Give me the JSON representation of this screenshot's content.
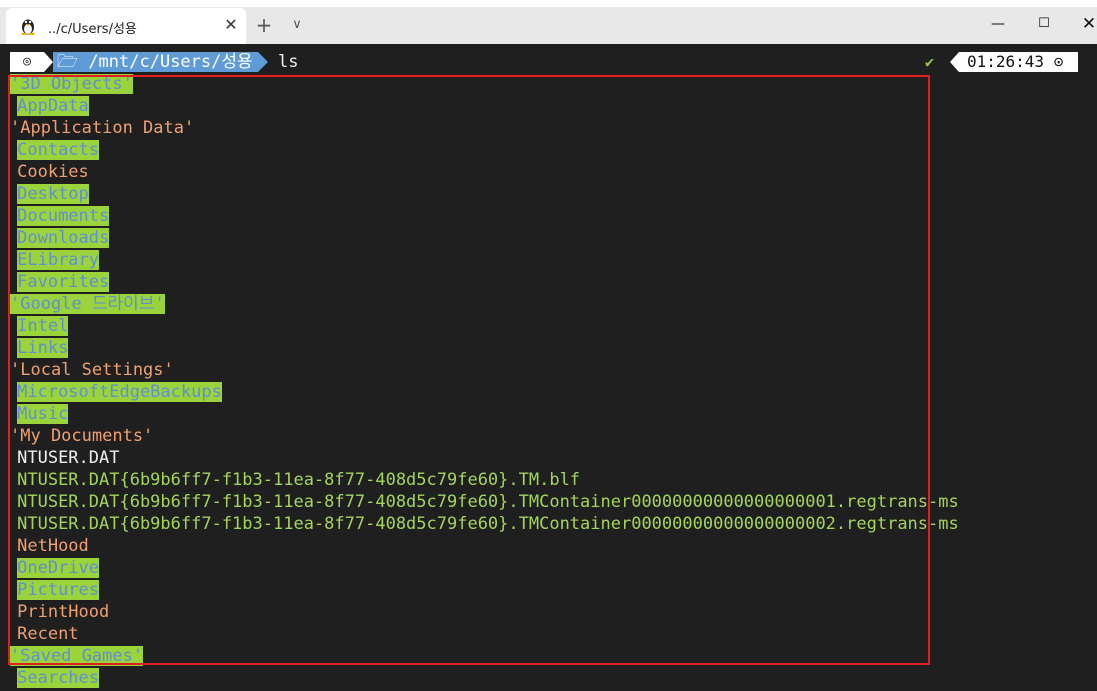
{
  "window": {
    "tab_title": "../c/Users/성용",
    "tab_icon": "linux-penguin-icon",
    "new_tab": "+",
    "tab_menu": "∨",
    "close_tab": "✕",
    "minimize": "—",
    "maximize": "☐",
    "close": "✕"
  },
  "prompt": {
    "os_icon": "◎",
    "path": "🗁 /mnt/c/Users/성용",
    "command": "ls",
    "status_icon": "✔",
    "time": "01:26:43 ⊙"
  },
  "colors": {
    "highlight_bg": "#9bd43a",
    "highlight_fg": "#5f8fd3",
    "orange": "#f0a070",
    "green": "#a3d55a",
    "path_bg": "#5e9bd7",
    "annotation_red": "#e02020"
  },
  "entries": [
    {
      "text": "'3D Objects'",
      "style": "dir-hl",
      "indent": 0
    },
    {
      "text": "AppData",
      "style": "dir-hl",
      "indent": 1
    },
    {
      "text": "'Application Data'",
      "style": "dir-plain",
      "indent": 0
    },
    {
      "text": "Contacts",
      "style": "dir-hl",
      "indent": 1
    },
    {
      "text": "Cookies",
      "style": "dir-plain",
      "indent": 1
    },
    {
      "text": "Desktop",
      "style": "dir-hl",
      "indent": 1
    },
    {
      "text": "Documents",
      "style": "dir-hl",
      "indent": 1
    },
    {
      "text": "Downloads",
      "style": "dir-hl",
      "indent": 1
    },
    {
      "text": "ELibrary",
      "style": "dir-hl",
      "indent": 1
    },
    {
      "text": "Favorites",
      "style": "dir-hl",
      "indent": 1
    },
    {
      "text": "'Google 드라이브'",
      "style": "dir-hl",
      "indent": 0
    },
    {
      "text": "Intel",
      "style": "dir-hl",
      "indent": 1
    },
    {
      "text": "Links",
      "style": "dir-hl",
      "indent": 1
    },
    {
      "text": "'Local Settings'",
      "style": "dir-plain",
      "indent": 0
    },
    {
      "text": "MicrosoftEdgeBackups",
      "style": "dir-hl",
      "indent": 1
    },
    {
      "text": "Music",
      "style": "dir-hl",
      "indent": 1
    },
    {
      "text": "'My Documents'",
      "style": "dir-plain",
      "indent": 0
    },
    {
      "text": "NTUSER.DAT",
      "style": "file-plain",
      "indent": 1
    },
    {
      "text": "NTUSER.DAT{6b9b6ff7-f1b3-11ea-8f77-408d5c79fe60}.TM.blf",
      "style": "file-green",
      "indent": 1
    },
    {
      "text": "NTUSER.DAT{6b9b6ff7-f1b3-11ea-8f77-408d5c79fe60}.TMContainer00000000000000000001.regtrans-ms",
      "style": "file-green",
      "indent": 1
    },
    {
      "text": "NTUSER.DAT{6b9b6ff7-f1b3-11ea-8f77-408d5c79fe60}.TMContainer00000000000000000002.regtrans-ms",
      "style": "file-green",
      "indent": 1
    },
    {
      "text": "NetHood",
      "style": "dir-plain",
      "indent": 1
    },
    {
      "text": "OneDrive",
      "style": "dir-hl",
      "indent": 1
    },
    {
      "text": "Pictures",
      "style": "dir-hl",
      "indent": 1
    },
    {
      "text": "PrintHood",
      "style": "dir-plain",
      "indent": 1
    },
    {
      "text": "Recent",
      "style": "dir-plain",
      "indent": 1
    },
    {
      "text": "'Saved Games'",
      "style": "dir-hl",
      "indent": 0
    },
    {
      "text": "Searches",
      "style": "dir-hl",
      "indent": 1
    }
  ]
}
